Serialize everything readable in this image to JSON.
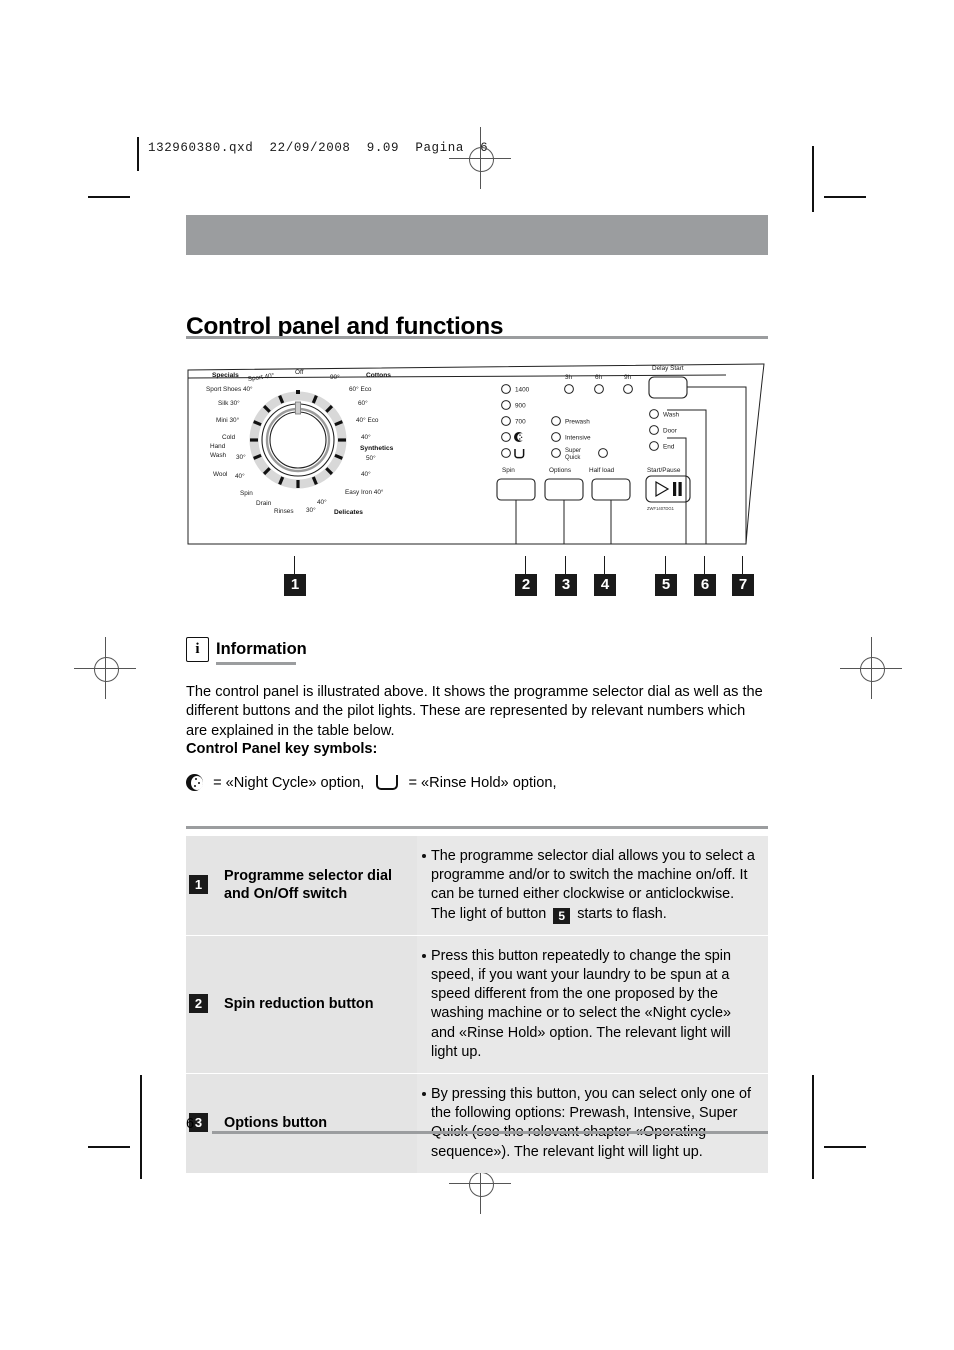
{
  "print_header": "132960380.qxd  22/09/2008  9.09  Pagina  6",
  "page_number": "6",
  "heading": "Control panel and functions",
  "panel": {
    "dial": {
      "group_left_label": "Specials",
      "group_right_label": "Cottons",
      "group_bottom_right_label": "Delicates",
      "group_synthetics_label": "Synthetics",
      "off_label": "Off",
      "labels_right": [
        "90°",
        "60° Eco",
        "60°",
        "40° Eco",
        "40°",
        "50°",
        "40°",
        "Easy Iron 40°",
        "40°",
        "30°"
      ],
      "labels_left": [
        "Sport 40°",
        "Sport Shoes 40°",
        "Silk 30°",
        "Mini 30°",
        "Cold",
        "Hand Wash",
        "30°",
        "Wool 40°",
        "Spin",
        "Drain",
        "Rinses"
      ]
    },
    "spin": {
      "group_label": "Spin",
      "options": [
        "1400",
        "900",
        "700",
        "night-cycle-icon",
        "rinse-hold-icon"
      ]
    },
    "options": {
      "group_label": "Options",
      "items": [
        "Prewash",
        "Intensive",
        "Super Quick"
      ]
    },
    "half_load": {
      "group_label": "Half load"
    },
    "delay_start": {
      "title": "Delay Start",
      "hours": [
        "3h",
        "6h",
        "9h"
      ]
    },
    "status_lights": [
      "Wash",
      "Door",
      "End"
    ],
    "start_pause": {
      "label": "Start/Pause"
    },
    "model_code": "ZWF1407DG1",
    "callouts": [
      "1",
      "2",
      "3",
      "4",
      "5",
      "6",
      "7"
    ]
  },
  "information": {
    "icon": "info-icon",
    "title": "Information",
    "body": "The control panel is illustrated above. It shows the programme selector dial as well as the different buttons and the pilot lights. These are represented by relevant numbers which are explained in the table below."
  },
  "key_symbols": {
    "heading": "Control Panel key symbols:",
    "night_text": "= «Night Cycle» option,",
    "rinse_text": "= «Rinse Hold» option,"
  },
  "table": {
    "rows": [
      {
        "num": "1",
        "label": "Programme selector dial and On/Off switch",
        "desc_part1": "The programme selector dial allows you to select a programme and/or to switch the machine on/off. It can be turned either clockwise or anticlockwise. The light of button",
        "inline_badge": "5",
        "desc_part2": "starts to flash."
      },
      {
        "num": "2",
        "label": "Spin reduction button",
        "desc": "Press this button repeatedly to change the spin speed, if you want your laundry to be spun at a speed different from the one proposed by the washing machine or to select the «Night cycle» and «Rinse Hold» option. The relevant light will light up."
      },
      {
        "num": "3",
        "label": "Options button",
        "desc": "By pressing this button, you can select only one of the following options: Prewash, Intensive, Super Quick (see the relevant chapter «Operating sequence»). The relevant light will light up."
      }
    ]
  }
}
